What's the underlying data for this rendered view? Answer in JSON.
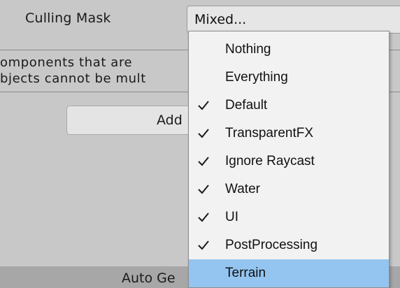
{
  "field": {
    "label": "Culling Mask",
    "value": "Mixed..."
  },
  "info": {
    "line1": "omponents that are",
    "line2": "bjects cannot be mult"
  },
  "add_button": {
    "label": "Add"
  },
  "bottom_bar": {
    "label": "Auto Ge"
  },
  "dropdown": {
    "highlight_color": "#93c5f0",
    "items": [
      {
        "label": "Nothing",
        "checked": false,
        "highlighted": false
      },
      {
        "label": "Everything",
        "checked": false,
        "highlighted": false
      },
      {
        "label": "Default",
        "checked": true,
        "highlighted": false
      },
      {
        "label": "TransparentFX",
        "checked": true,
        "highlighted": false
      },
      {
        "label": "Ignore Raycast",
        "checked": true,
        "highlighted": false
      },
      {
        "label": "Water",
        "checked": true,
        "highlighted": false
      },
      {
        "label": "UI",
        "checked": true,
        "highlighted": false
      },
      {
        "label": "PostProcessing",
        "checked": true,
        "highlighted": false
      },
      {
        "label": "Terrain",
        "checked": false,
        "highlighted": true
      }
    ]
  }
}
